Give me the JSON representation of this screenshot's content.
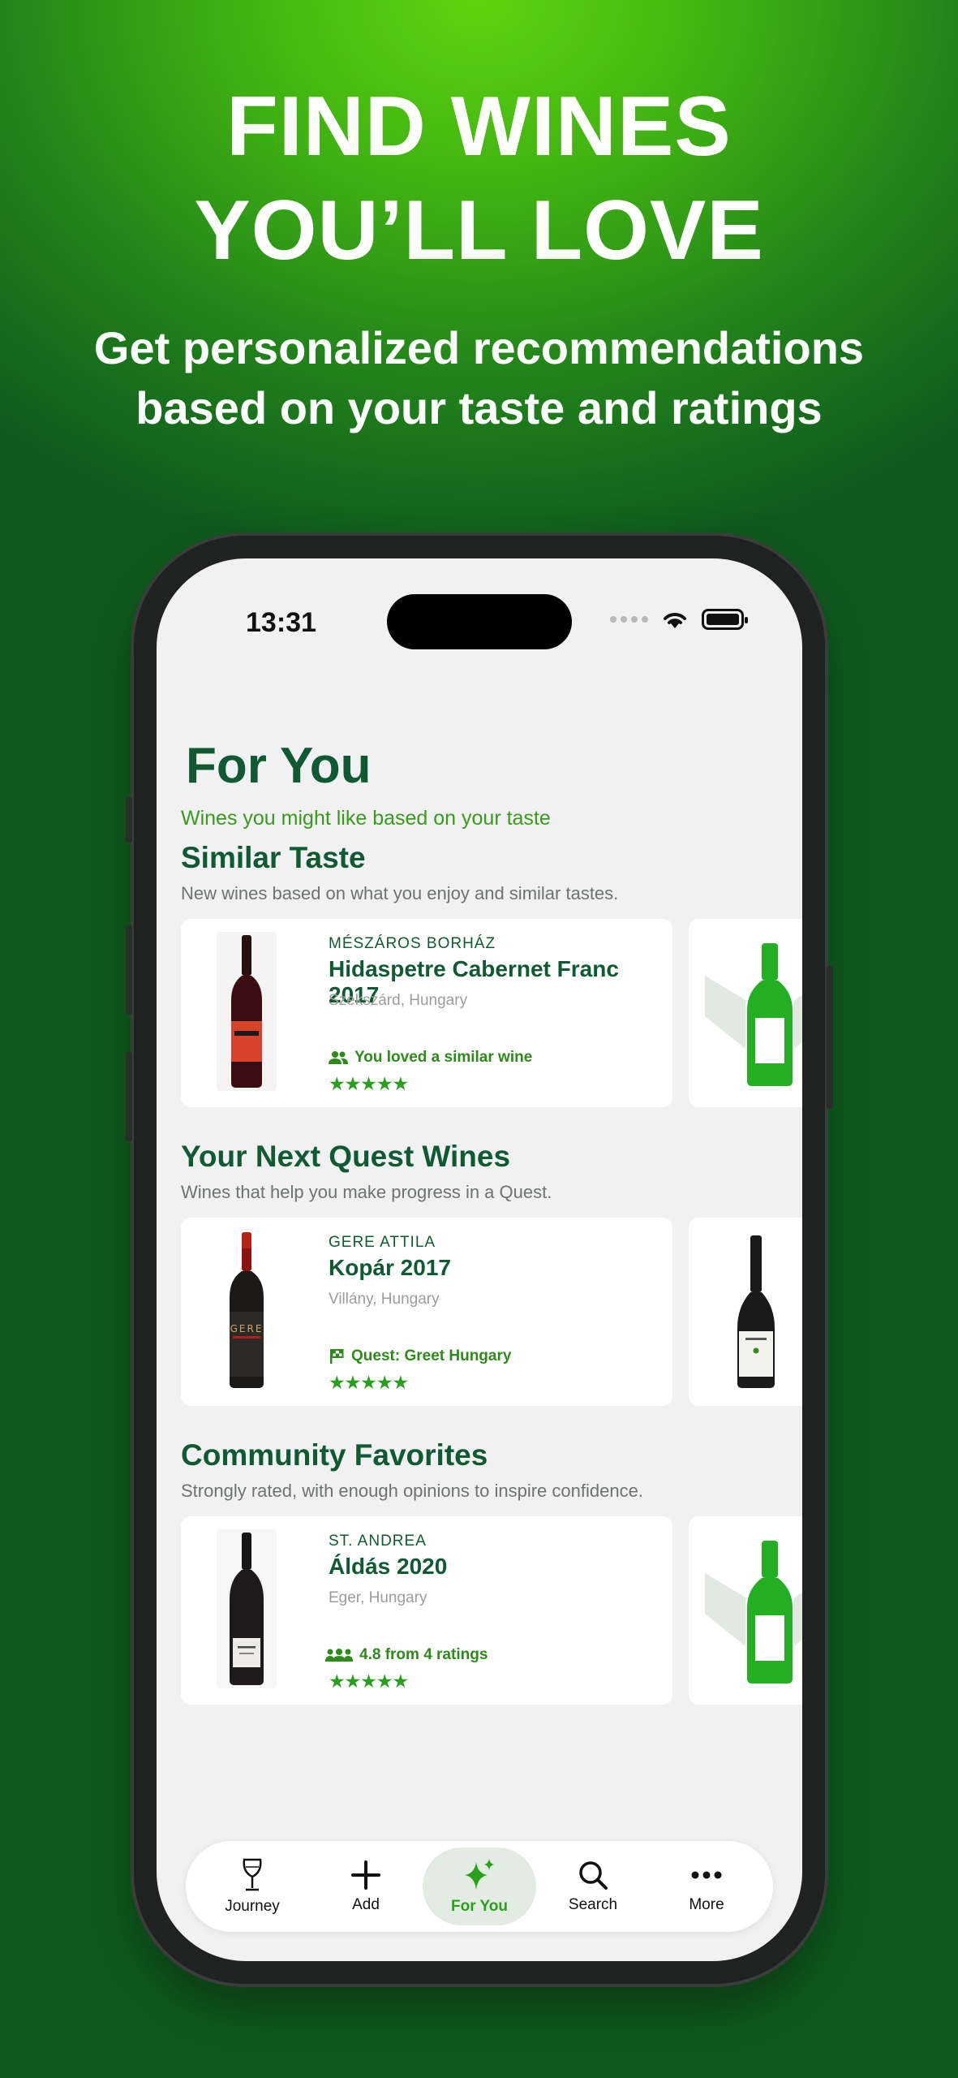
{
  "promo": {
    "headline_line1": "FIND WINES",
    "headline_line2": "YOU’LL LOVE",
    "subhead_line1": "Get personalized recommendations",
    "subhead_line2": "based on your taste and ratings"
  },
  "status_bar": {
    "time": "13:31"
  },
  "page": {
    "title": "For You",
    "subtitle": "Wines you might like based on your taste"
  },
  "sections": [
    {
      "title": "Similar Taste",
      "subtitle": "New wines based on what you enjoy and similar tastes.",
      "card": {
        "winery": "MÉSZÁROS BORHÁZ",
        "name": "Hidaspetre Cabernet Franc 2017",
        "region": "Szekszárd, Hungary",
        "reason": "You loved a similar wine",
        "reason_icon": "people-icon",
        "stars": "★★★★★",
        "rating": 5
      }
    },
    {
      "title": "Your Next Quest Wines",
      "subtitle": "Wines that help you make progress in a Quest.",
      "card": {
        "winery": "GERE ATTILA",
        "name": "Kopár 2017",
        "region": "Villány, Hungary",
        "reason": "Quest: Greet Hungary",
        "reason_icon": "flag-icon",
        "stars": "★★★★★",
        "rating": 5
      }
    },
    {
      "title": "Community Favorites",
      "subtitle": "Strongly rated, with enough opinions to inspire confidence.",
      "card": {
        "winery": "ST. ANDREA",
        "name": "Áldás 2020",
        "region": "Eger, Hungary",
        "reason": "4.8 from 4 ratings",
        "reason_icon": "group-icon",
        "stars": "★★★★★",
        "rating": 5
      }
    }
  ],
  "tabbar": {
    "journey": "Journey",
    "add": "Add",
    "for_you": "For You",
    "search": "Search",
    "more": "More"
  },
  "colors": {
    "brand_green": "#29a01b",
    "dark_green": "#0f5a32",
    "background_top": "#5ed40e",
    "background_bottom": "#0f5a1e"
  }
}
